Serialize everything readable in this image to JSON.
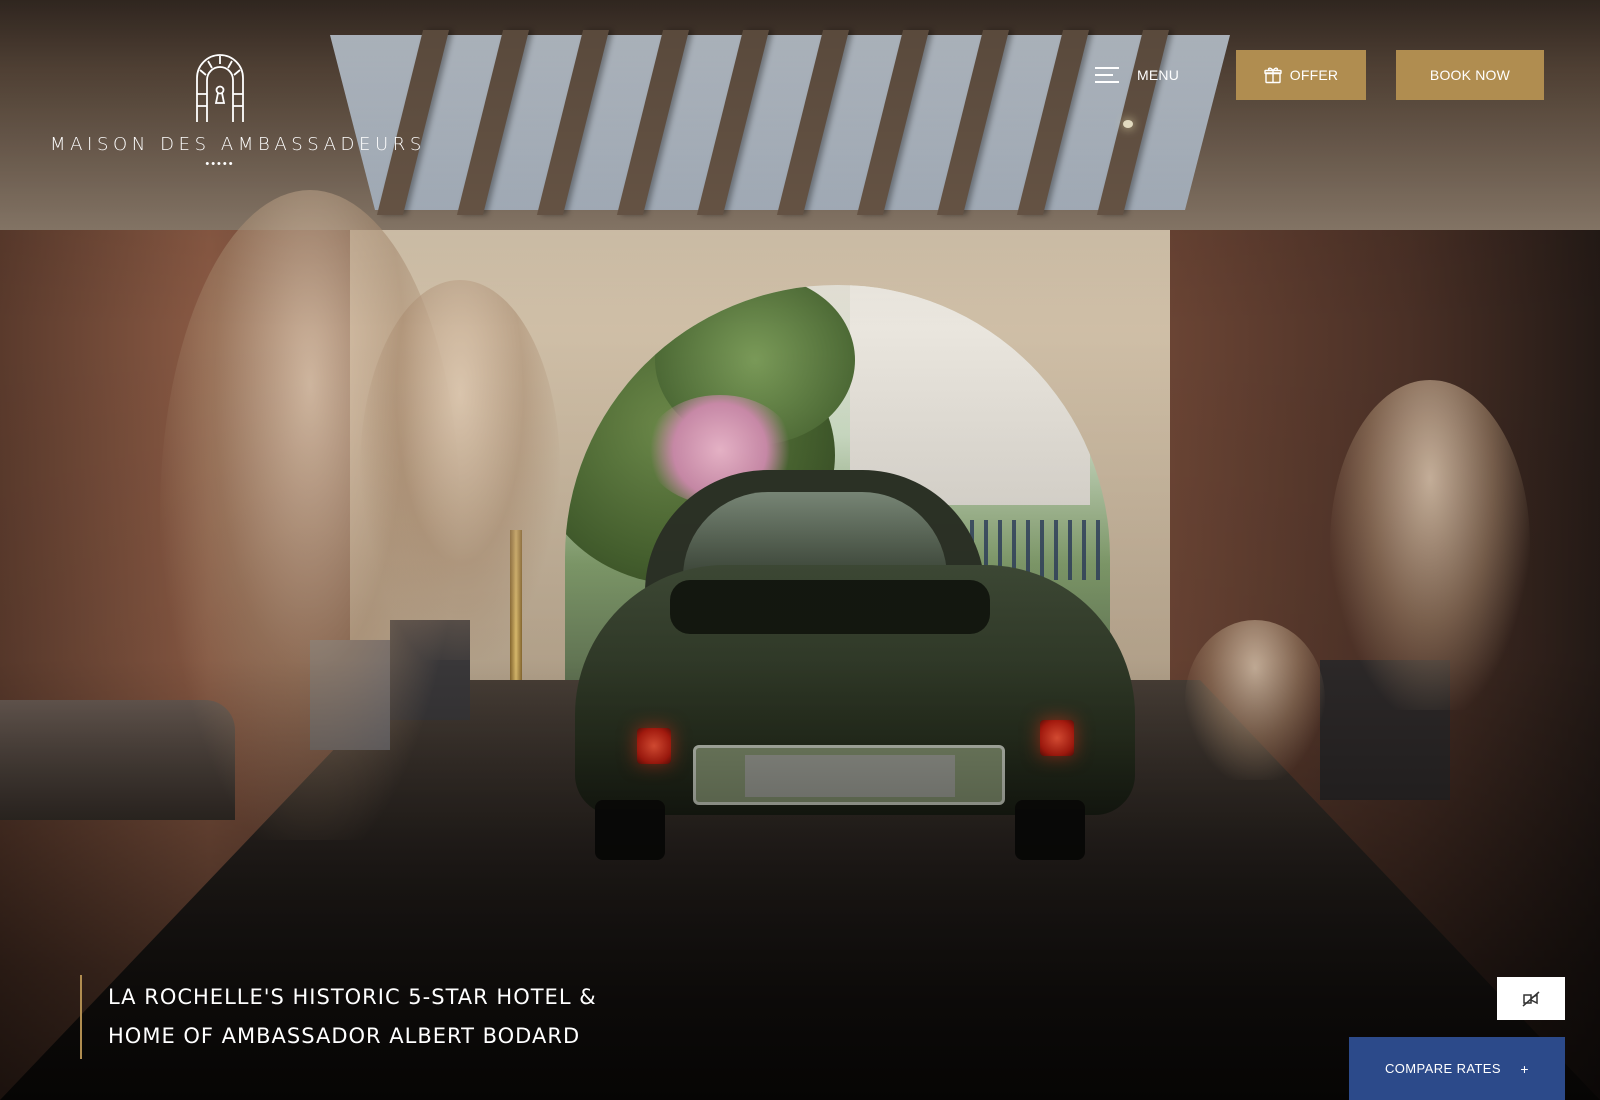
{
  "header": {
    "logo": {
      "name": "MAISON DES AMBASSADEURS",
      "ornament": "•••••"
    },
    "menu": {
      "icon": "hamburger-icon",
      "label": "MENU"
    },
    "offer_button": {
      "icon": "gift-icon",
      "label": "OFFER"
    },
    "book_button": {
      "label": "BOOK NOW"
    }
  },
  "hero": {
    "tagline_line1": "LA ROCHELLE'S HISTORIC 5-STAR HOTEL &",
    "tagline_line2": "HOME OF AMBASSADOR ALBERT BODARD"
  },
  "controls": {
    "mute_icon": "video-off-icon",
    "compare_rates": {
      "label": "COMPARE RATES",
      "toggle": "+"
    }
  },
  "colors": {
    "gold": "#b08d50",
    "blue": "#2c4a8a",
    "white": "#ffffff"
  }
}
